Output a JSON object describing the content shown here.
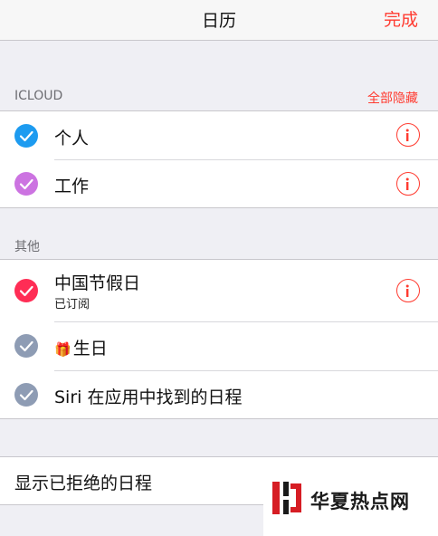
{
  "nav": {
    "title": "日历",
    "done": "完成"
  },
  "icloud": {
    "header": "ICLOUD",
    "hide_all": "全部隐藏",
    "items": [
      {
        "label": "个人",
        "color": "#1d9bf0"
      },
      {
        "label": "工作",
        "color": "#cc73e1"
      }
    ]
  },
  "other": {
    "header": "其他",
    "items": [
      {
        "label": "中国节假日",
        "sublabel": "已订阅",
        "color": "#ff2d55"
      },
      {
        "label": "生日",
        "icon": "gift-icon",
        "color": "#8e9cb4"
      },
      {
        "label": "Siri 在应用中找到的日程",
        "color": "#8e9cb4"
      }
    ]
  },
  "declined": {
    "label": "显示已拒绝的日程"
  },
  "watermark": {
    "text": "华夏热点网"
  },
  "colors": {
    "accent": "#ff3b30",
    "info_icon": "#ff3b30"
  }
}
